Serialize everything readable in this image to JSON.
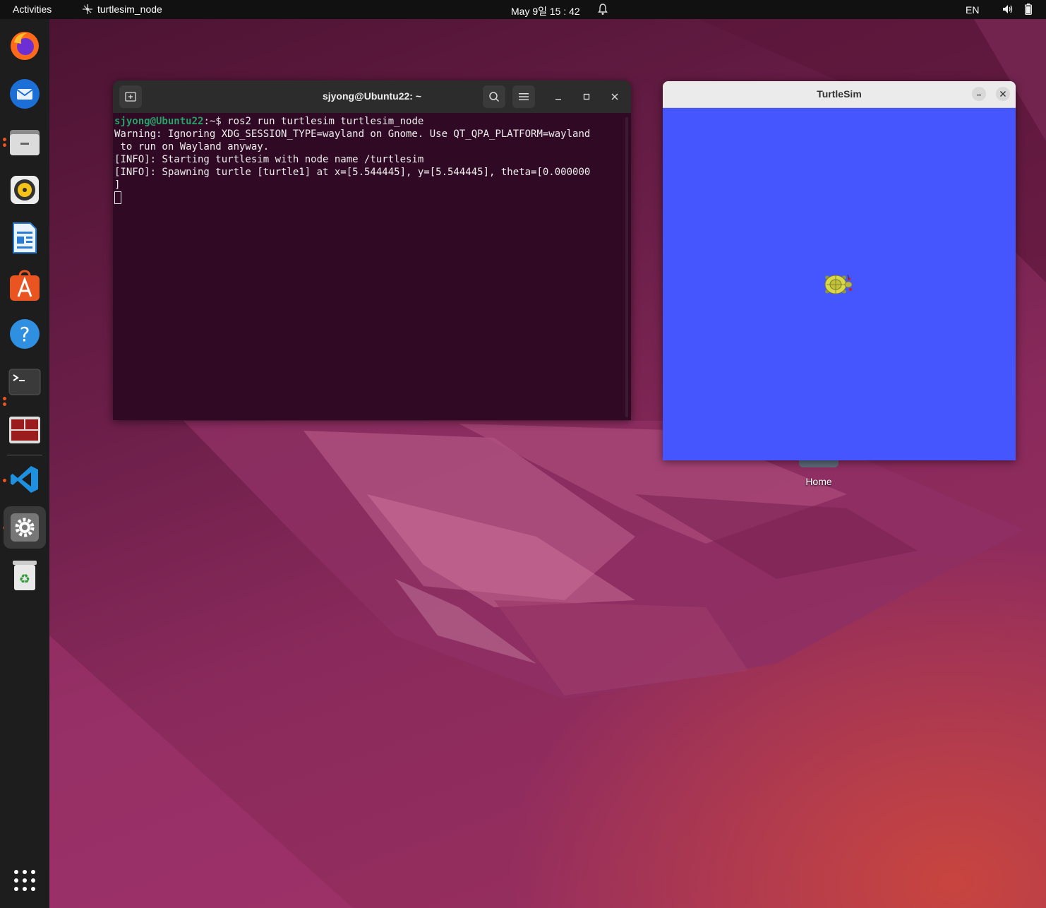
{
  "topbar": {
    "activities_label": "Activities",
    "app_name": "turtlesim_node",
    "clock": "May 9일  15 : 42",
    "language": "EN"
  },
  "dock": {
    "items": [
      {
        "name": "firefox",
        "icon": "firefox-icon"
      },
      {
        "name": "thunderbird",
        "icon": "thunderbird-icon"
      },
      {
        "name": "files",
        "icon": "files-icon"
      },
      {
        "name": "rhythmbox",
        "icon": "rhythmbox-icon"
      },
      {
        "name": "libreoffice-writer",
        "icon": "writer-icon"
      },
      {
        "name": "app-center",
        "icon": "app-center-icon"
      },
      {
        "name": "help",
        "icon": "help-icon"
      },
      {
        "name": "terminal",
        "icon": "terminal-icon"
      },
      {
        "name": "terminator",
        "icon": "terminator-icon"
      },
      {
        "name": "vscode",
        "icon": "vscode-icon"
      },
      {
        "name": "settings",
        "icon": "settings-icon"
      },
      {
        "name": "trash",
        "icon": "trash-icon"
      },
      {
        "name": "show-apps",
        "icon": "app-grid-icon"
      }
    ]
  },
  "terminal": {
    "title": "sjyong@Ubuntu22: ~",
    "prompt_user": "sjyong@Ubuntu22",
    "prompt_rest": ":~$ ros2 run turtlesim turtlesim_node",
    "lines": [
      "Warning: Ignoring XDG_SESSION_TYPE=wayland on Gnome. Use QT_QPA_PLATFORM=wayland",
      " to run on Wayland anyway.",
      "[INFO]: Starting turtlesim with node name /turtlesim",
      "[INFO]: Spawning turtle [turtle1] at x=[5.544445], y=[5.544445], theta=[0.000000",
      "]"
    ]
  },
  "turtlesim": {
    "title": "TurtleSim",
    "background_color": "#4556ff"
  },
  "desktop": {
    "home_label": "Home"
  }
}
